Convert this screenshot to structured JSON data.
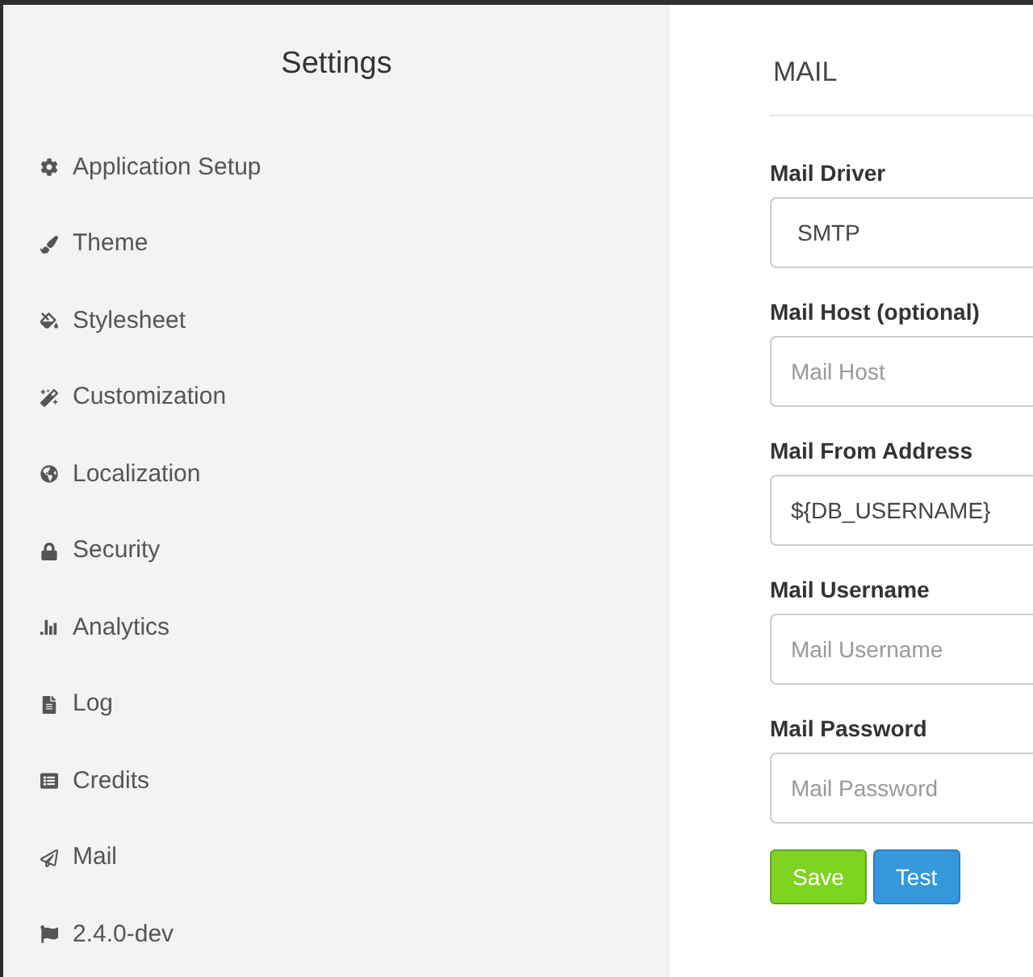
{
  "sidebar": {
    "title": "Settings",
    "items": [
      {
        "label": "Application Setup"
      },
      {
        "label": "Theme"
      },
      {
        "label": "Stylesheet"
      },
      {
        "label": "Customization"
      },
      {
        "label": "Localization"
      },
      {
        "label": "Security"
      },
      {
        "label": "Analytics"
      },
      {
        "label": "Log"
      },
      {
        "label": "Credits"
      },
      {
        "label": "Mail"
      },
      {
        "label": "2.4.0-dev"
      }
    ]
  },
  "panel": {
    "title": "MAIL",
    "fields": [
      {
        "label": "Mail Driver",
        "kind": "select",
        "value": "SMTP"
      },
      {
        "label": "Mail Host (optional)",
        "kind": "text",
        "placeholder": "Mail Host"
      },
      {
        "label": "Mail From Address",
        "kind": "text",
        "value": "${DB_USERNAME}"
      },
      {
        "label": "Mail Username",
        "kind": "text",
        "placeholder": "Mail Username"
      },
      {
        "label": "Mail Password",
        "kind": "password",
        "placeholder": "Mail Password"
      }
    ],
    "buttons": [
      {
        "label": "Save",
        "kind": "success"
      },
      {
        "label": "Test",
        "kind": "info"
      }
    ]
  }
}
